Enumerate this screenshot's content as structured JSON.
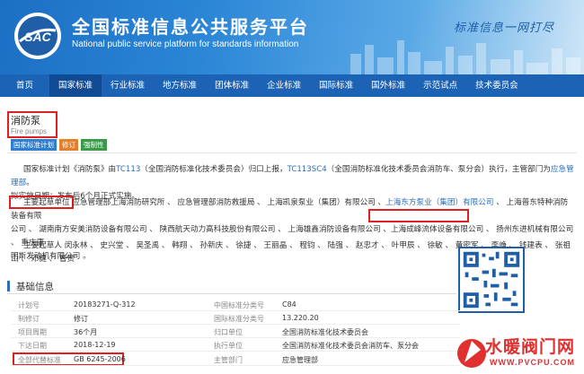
{
  "header": {
    "logo_text": "SAC",
    "title": "全国标准信息公共服务平台",
    "subtitle": "National public service platform  for standards information",
    "slogan": "标准信息一网打尽"
  },
  "nav": [
    "首页",
    "国家标准",
    "行业标准",
    "地方标准",
    "团体标准",
    "企业标准",
    "国际标准",
    "国外标准",
    "示范试点",
    "技术委员会"
  ],
  "nav_active_index": 1,
  "standard": {
    "title": "消防泵",
    "title_en": "Fire pumps",
    "badges": [
      "国家标准计划",
      "修订",
      "强制性"
    ]
  },
  "intro": {
    "p1_a": "国家标准计划《消防泵》由",
    "tc1": "TC113",
    "p1_b": "（全国消防标准化技术委员会）归口上报，",
    "tc2": "TC113SC4",
    "p1_c": "（全国消防标准化技术委员会消防车、泵分会）执行，主管部门为",
    "dept": "应急管理部",
    "p1_d": "。",
    "p2": "拟实施日期：发布后6个月正式实施。"
  },
  "drafters": {
    "label": "主要起草单位",
    "line1_a": " 应急管理部上海消防研究所 、 应急管理部消防救援局 、 上海凯泉泵业（集团）有限公司 、",
    "line1_b": "上海东方泵业（集团）有限公司",
    "line1_c": " 、 上海普东特种消防装备有限",
    "line2_a": "公司 、 湖南南方安美消防设备有限公司 、 陕西航天动力高科技股份有限公司 、 上海雄鑫消防设备有限公司 、",
    "line2_b": "上海成峰流体设备有限公司",
    "line2_c": " 、 扬州东进机械有限公司 、 重庆康",
    "line3": "明斯发动机有限公司 。"
  },
  "drafters_people": {
    "label": "主要起草人",
    "names": " 闵永林 、 史兴堂 、 吴圣禹 、 韩翔 、 孙新庆 、 徐捷 、 王丽晶 、 程钧 、 陆强 、 赵忠才 、 叶甲辰 、 徐敏 、 黄密军 、 李峥 、 钱建表 、 张祖山 、 邓健 、 曹贵"
  },
  "basic_info": {
    "heading": "基础信息",
    "rows": [
      {
        "k1": "计划号",
        "v1": "20183271-Q-312",
        "k2": "中国标准分类号",
        "v2": "C84"
      },
      {
        "k1": "制修订",
        "v1": "修订",
        "k2": "国际标准分类号",
        "v2": "13.220.20"
      },
      {
        "k1": "项目周期",
        "v1": "36个月",
        "k2": "归口单位",
        "v2": "全国消防标准化技术委员会"
      },
      {
        "k1": "下达日期",
        "v1": "2018-12-19",
        "k2": "执行单位",
        "v2": "全国消防标准化技术委员会消防车、泵分会"
      },
      {
        "k1": "全部代替标准",
        "v1": "GB 6245-2006",
        "k2": "主管部门",
        "v2": "应急管理部"
      }
    ]
  },
  "watermark": {
    "brand": "水暖阀门网",
    "url": "WWW.PVCPU.COM"
  },
  "colors": {
    "header_blue": "#1c6fc4",
    "nav_blue": "#1d63b5",
    "link_blue": "#2a6ebd",
    "highlight_red": "#e02020"
  }
}
